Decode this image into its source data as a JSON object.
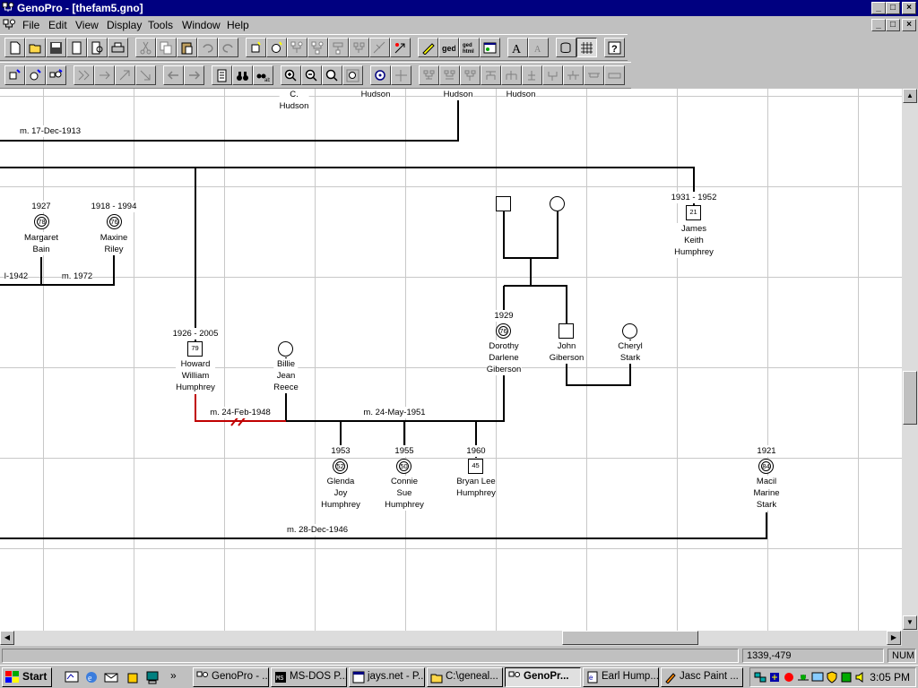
{
  "window": {
    "app_title": "GenoPro - [thefam5.gno]",
    "minimize": "_",
    "maximize": "□",
    "close": "×"
  },
  "menu": {
    "items": [
      {
        "label": "File"
      },
      {
        "label": "Edit"
      },
      {
        "label": "View"
      },
      {
        "label": "Display"
      },
      {
        "label": "Tools"
      },
      {
        "label": "Window"
      },
      {
        "label": "Help"
      }
    ]
  },
  "toolbar": {
    "ged_label": "ged",
    "ged_html_label": "ged\nhtml"
  },
  "tree": {
    "top_labels": [
      "C.\nHudson",
      "Hudson",
      "Hudson",
      "Hudson"
    ],
    "marriages": [
      "m. 17-Dec-1913",
      "l-1942",
      "m. 1972",
      "m. 24-Feb-1948",
      "m. 24-May-1951",
      "m. 28-Dec-1946"
    ],
    "people": [
      {
        "years": "1927",
        "age": "78",
        "name": "Margaret\nBain"
      },
      {
        "years": "1918 - 1994",
        "age": "76",
        "name": "Maxine\nRiley"
      },
      {
        "years": "1931 - 1952",
        "age": "21",
        "name": "James\nKeith\nHumphrey"
      },
      {
        "years": "1926 - 2005",
        "age": "79",
        "name": "Howard\nWilliam\nHumphrey"
      },
      {
        "years": "",
        "age": "",
        "name": "Billie\nJean\nReece"
      },
      {
        "years": "1929",
        "age": "76",
        "name": "Dorothy\nDarlene\nGiberson"
      },
      {
        "years": "",
        "age": "",
        "name": "John\nGiberson"
      },
      {
        "years": "",
        "age": "",
        "name": "Cheryl\nStark"
      },
      {
        "years": "1953",
        "age": "52",
        "name": "Glenda\nJoy\nHumphrey"
      },
      {
        "years": "1955",
        "age": "50",
        "name": "Connie\nSue\nHumphrey"
      },
      {
        "years": "1960",
        "age": "45",
        "name": "Bryan Lee\nHumphrey"
      },
      {
        "years": "1921",
        "age": "84",
        "name": "Macil\nMarine\nStark"
      }
    ]
  },
  "status": {
    "coords": "1339,-479",
    "num": "NUM"
  },
  "taskbar": {
    "start": "Start",
    "tasks": [
      {
        "label": "GenoPro - ..."
      },
      {
        "label": "MS-DOS P..."
      },
      {
        "label": "jays.net - P..."
      },
      {
        "label": "C:\\geneal..."
      },
      {
        "label": "GenoPr..."
      },
      {
        "label": "Earl Hump..."
      },
      {
        "label": "Jasc Paint ..."
      }
    ],
    "more": "»",
    "clock": "3:05 PM"
  },
  "colors": {
    "titlebar": "#000080",
    "divorce_line": "#c00000"
  }
}
